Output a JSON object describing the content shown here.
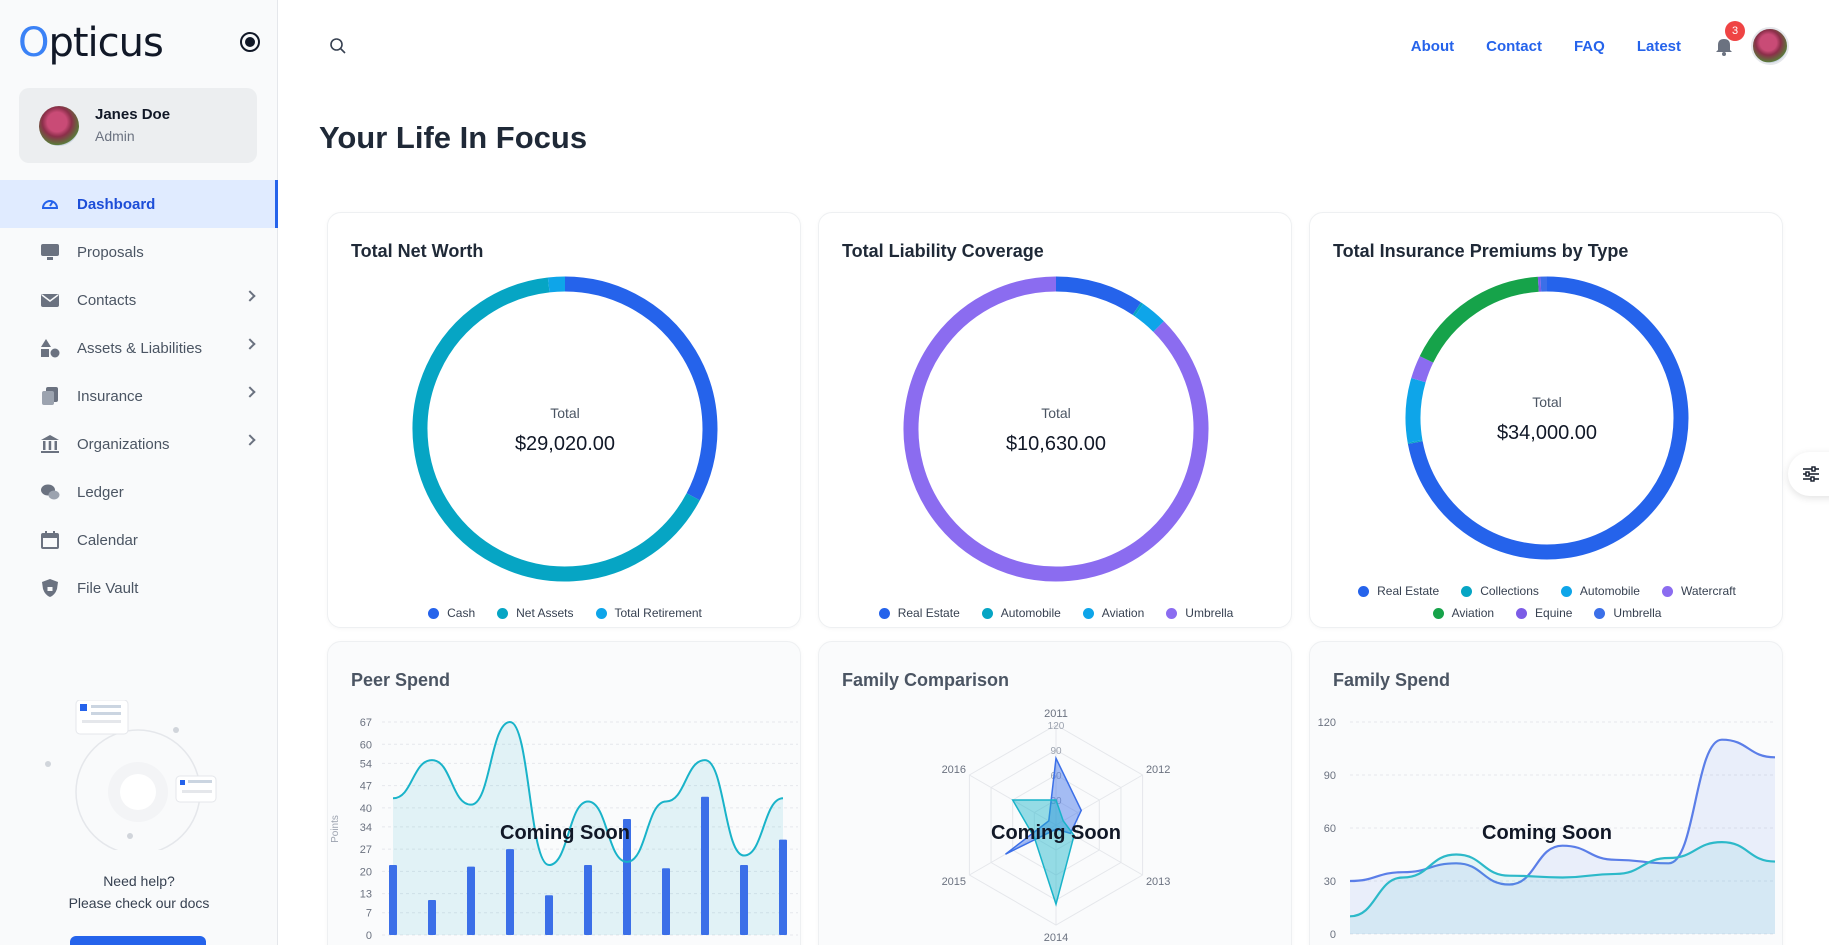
{
  "app": {
    "logo_text": "Opticus"
  },
  "user": {
    "name": "Janes Doe",
    "role": "Admin"
  },
  "sidebar": {
    "items": [
      {
        "label": "Dashboard",
        "icon": "dashboard-gauge-icon",
        "active": true,
        "has_children": false
      },
      {
        "label": "Proposals",
        "icon": "monitor-icon",
        "active": false,
        "has_children": false
      },
      {
        "label": "Contacts",
        "icon": "envelope-icon",
        "active": false,
        "has_children": true
      },
      {
        "label": "Assets & Liabilities",
        "icon": "shapes-icon",
        "active": false,
        "has_children": true
      },
      {
        "label": "Insurance",
        "icon": "documents-icon",
        "active": false,
        "has_children": true
      },
      {
        "label": "Organizations",
        "icon": "bank-icon",
        "active": false,
        "has_children": true
      },
      {
        "label": "Ledger",
        "icon": "chat-bubbles-icon",
        "active": false,
        "has_children": false
      },
      {
        "label": "Calendar",
        "icon": "calendar-icon",
        "active": false,
        "has_children": false
      },
      {
        "label": "File Vault",
        "icon": "shield-lock-icon",
        "active": false,
        "has_children": false
      }
    ],
    "help": {
      "line1": "Need help?",
      "line2": "Please check our docs"
    }
  },
  "topnav": {
    "links": [
      "About",
      "Contact",
      "FAQ",
      "Latest"
    ],
    "notification_count": "3"
  },
  "page": {
    "title": "Your Life In Focus"
  },
  "colors": {
    "blue": "#2563eb",
    "teal": "#06a5c4",
    "sky": "#0ea5e9",
    "purple": "#8b6cf0",
    "green": "#16a34a",
    "violet": "#7c5ce6"
  },
  "chart_data": [
    {
      "type": "pie",
      "title": "Total Net Worth",
      "center_label": "Total",
      "center_value": "$29,020.00",
      "categories": [
        "Cash",
        "Net Assets",
        "Total Retirement"
      ],
      "values": [
        9500,
        19000,
        520
      ],
      "colors": [
        "#2563eb",
        "#06a5c4",
        "#0ea5e9"
      ]
    },
    {
      "type": "pie",
      "title": "Total Liability Coverage",
      "center_label": "Total",
      "center_value": "$10,630.00",
      "categories": [
        "Real Estate",
        "Automobile",
        "Aviation",
        "Umbrella"
      ],
      "values": [
        1000,
        30,
        300,
        9300
      ],
      "colors": [
        "#2563eb",
        "#06a5c4",
        "#0ea5e9",
        "#8b6cf0"
      ]
    },
    {
      "type": "pie",
      "title": "Total Insurance Premiums by Type",
      "center_label": "Total",
      "center_value": "$34,000.00",
      "categories": [
        "Real Estate",
        "Collections",
        "Automobile",
        "Watercraft",
        "Aviation",
        "Equine",
        "Umbrella"
      ],
      "values": [
        24500,
        50,
        2500,
        900,
        5700,
        100,
        250
      ],
      "colors": [
        "#2563eb",
        "#06a5c4",
        "#0ea5e9",
        "#8b6cf0",
        "#16a34a",
        "#7c5ce6",
        "#3b6fe8"
      ]
    },
    {
      "type": "bar",
      "title": "Peer Spend",
      "overlay_text": "Coming Soon",
      "ylabel": "Points",
      "y_ticks": [
        "0",
        "7",
        "13",
        "20",
        "27",
        "34",
        "40",
        "47",
        "54",
        "60",
        "67"
      ],
      "ylim": [
        0,
        67
      ],
      "bar_values": [
        22,
        11,
        21.5,
        27,
        12.5,
        22,
        36.5,
        21,
        43.5,
        22,
        30
      ],
      "line_values": [
        43,
        55,
        41,
        67,
        22,
        42,
        23,
        42,
        55,
        25,
        43
      ]
    },
    {
      "type": "radar",
      "title": "Family Comparison",
      "overlay_text": "Coming Soon",
      "axes": [
        "2011",
        "2012",
        "2013",
        "2014",
        "2015",
        "2016"
      ],
      "radial_ticks": [
        "30",
        "60",
        "90",
        "120"
      ],
      "rlim": [
        0,
        120
      ],
      "series": [
        {
          "values": [
            80,
            35,
            20,
            5,
            70,
            10
          ]
        },
        {
          "values": [
            30,
            10,
            25,
            95,
            30,
            60
          ]
        }
      ]
    },
    {
      "type": "area",
      "title": "Family Spend",
      "overlay_text": "Coming Soon",
      "y_ticks": [
        "0",
        "30",
        "60",
        "90",
        "120"
      ],
      "ylim": [
        0,
        120
      ],
      "series": [
        {
          "values": [
            30,
            35,
            40,
            28,
            50,
            42,
            40,
            110,
            100
          ]
        },
        {
          "values": [
            10,
            32,
            45,
            33,
            32,
            34,
            43,
            52,
            41
          ]
        }
      ]
    }
  ]
}
